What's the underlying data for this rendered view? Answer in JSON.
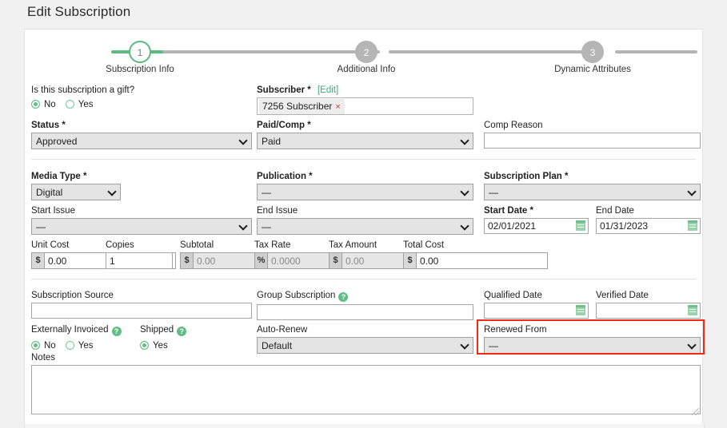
{
  "page": {
    "title": "Edit Subscription"
  },
  "stepper": {
    "steps": [
      {
        "number": "1",
        "label": "Subscription Info",
        "state": "active"
      },
      {
        "number": "2",
        "label": "Additional Info",
        "state": "idle"
      },
      {
        "number": "3",
        "label": "Dynamic Attributes",
        "state": "idle"
      }
    ],
    "progress_color": "#5cb97f",
    "track_color": "#b5b5b5"
  },
  "form": {
    "gift": {
      "label": "Is this subscription a gift?",
      "options": [
        "No",
        "Yes"
      ],
      "selected": "No"
    },
    "subscriber": {
      "label": "Subscriber *",
      "edit_link": "[Edit]",
      "token": "7256 Subscriber",
      "token_remove": "×"
    },
    "comp_reason": {
      "label": "Comp Reason",
      "value": "",
      "placeholder": ""
    },
    "status": {
      "label": "Status *",
      "value": "Approved",
      "options": [
        "Approved"
      ]
    },
    "paid_comp": {
      "label": "Paid/Comp *",
      "value": "Paid",
      "options": [
        "Paid"
      ]
    },
    "media_type": {
      "label": "Media Type *",
      "value": "Digital",
      "options": [
        "Digital"
      ]
    },
    "publication": {
      "label": "Publication *",
      "value": "—",
      "options": [
        "—"
      ]
    },
    "subscription_plan": {
      "label": "Subscription Plan *",
      "value": "—",
      "options": [
        "—"
      ]
    },
    "start_issue": {
      "label": "Start Issue",
      "value": "—",
      "options": [
        "—"
      ]
    },
    "end_issue": {
      "label": "End Issue",
      "value": "—",
      "options": [
        "—"
      ]
    },
    "start_date": {
      "label": "Start Date *",
      "value": "02/01/2021"
    },
    "end_date": {
      "label": "End Date",
      "value": "01/31/2023"
    },
    "unit_cost": {
      "label": "Unit Cost",
      "prefix": "$",
      "value": "0.00",
      "disabled": false
    },
    "copies": {
      "label": "Copies",
      "value": "1"
    },
    "subtotal": {
      "label": "Subtotal",
      "prefix": "$",
      "value": "0.00",
      "disabled": true
    },
    "tax_rate": {
      "label": "Tax Rate",
      "prefix": "%",
      "value": "0.0000",
      "disabled": true
    },
    "tax_amount": {
      "label": "Tax Amount",
      "prefix": "$",
      "value": "0.00",
      "disabled": true
    },
    "total_cost": {
      "label": "Total Cost",
      "prefix": "$",
      "value": "0.00",
      "disabled": false
    },
    "subscription_source": {
      "label": "Subscription Source",
      "value": ""
    },
    "group_subscription": {
      "label": "Group Subscription",
      "help": "?",
      "value": ""
    },
    "qualified_date": {
      "label": "Qualified Date",
      "value": ""
    },
    "verified_date": {
      "label": "Verified Date",
      "value": ""
    },
    "externally_invoiced": {
      "label": "Externally Invoiced",
      "help": "?",
      "options": [
        "No",
        "Yes"
      ],
      "selected": "No"
    },
    "shipped": {
      "label": "Shipped",
      "help": "?",
      "options": [
        "Yes"
      ],
      "selected": "Yes"
    },
    "auto_renew": {
      "label": "Auto-Renew",
      "value": "Default",
      "options": [
        "Default"
      ]
    },
    "renewed_from": {
      "label": "Renewed From",
      "value": "—",
      "options": [
        "—"
      ]
    },
    "notes": {
      "label": "Notes",
      "value": ""
    }
  },
  "annotation": {
    "color": "#f02a15",
    "target": "Renewed From"
  }
}
